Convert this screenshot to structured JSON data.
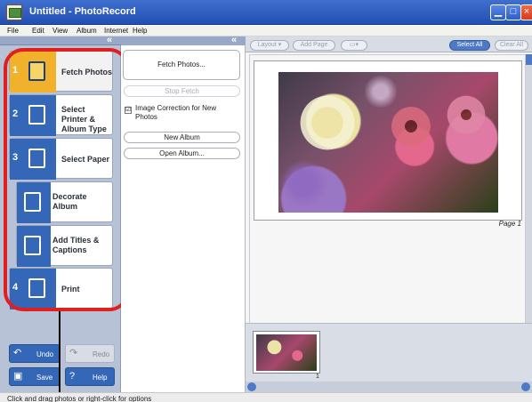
{
  "window": {
    "title": "Untitled - PhotoRecord",
    "buttons": [
      "minimize-icon",
      "maximize-icon",
      "close-icon"
    ]
  },
  "menu": {
    "items": [
      "File",
      "Edit",
      "View",
      "Album",
      "Internet",
      "Help"
    ]
  },
  "left_panel": {
    "collapse_glyph": "«",
    "steps": [
      {
        "number": "1",
        "label": "Fetch Photos",
        "icon": "fetch-photos-icon",
        "active": true
      },
      {
        "number": "2",
        "label": "Select Printer & Album Type",
        "icon": "printer-album-icon",
        "active": false
      },
      {
        "number": "3",
        "label": "Select Paper",
        "icon": "paper-icon",
        "active": false
      },
      {
        "number": "",
        "label": "Decorate Album",
        "icon": "decorate-icon",
        "active": false
      },
      {
        "number": "",
        "label": "Add Titles & Captions",
        "icon": "titles-icon",
        "active": false
      },
      {
        "number": "4",
        "label": "Print",
        "icon": "print-icon",
        "active": false
      }
    ],
    "tools": {
      "undo": "Undo",
      "redo": "Redo",
      "save": "Save",
      "help": "Help"
    }
  },
  "middle_panel": {
    "collapse_glyph": "«",
    "fetch_button": "Fetch Photos...",
    "stop_button": "Stop Fetch",
    "image_correction": "Image Correction for New Photos",
    "image_correction_checked": true,
    "new_album_button": "New Album",
    "open_album_button": "Open Album..."
  },
  "right_toolbar": {
    "layout": "Layout",
    "add_page": "Add Page",
    "select_all": "Select All",
    "clear_all": "Clear All"
  },
  "page": {
    "label": "Page 1",
    "thumbnail_number": "1"
  },
  "status": {
    "text": "Click and drag photos or right-click for options"
  },
  "colors": {
    "title_bar": "#2f5fc6",
    "step_blue": "#3567b8",
    "active_step": "#f1b12b",
    "callout_red": "#e02020"
  }
}
